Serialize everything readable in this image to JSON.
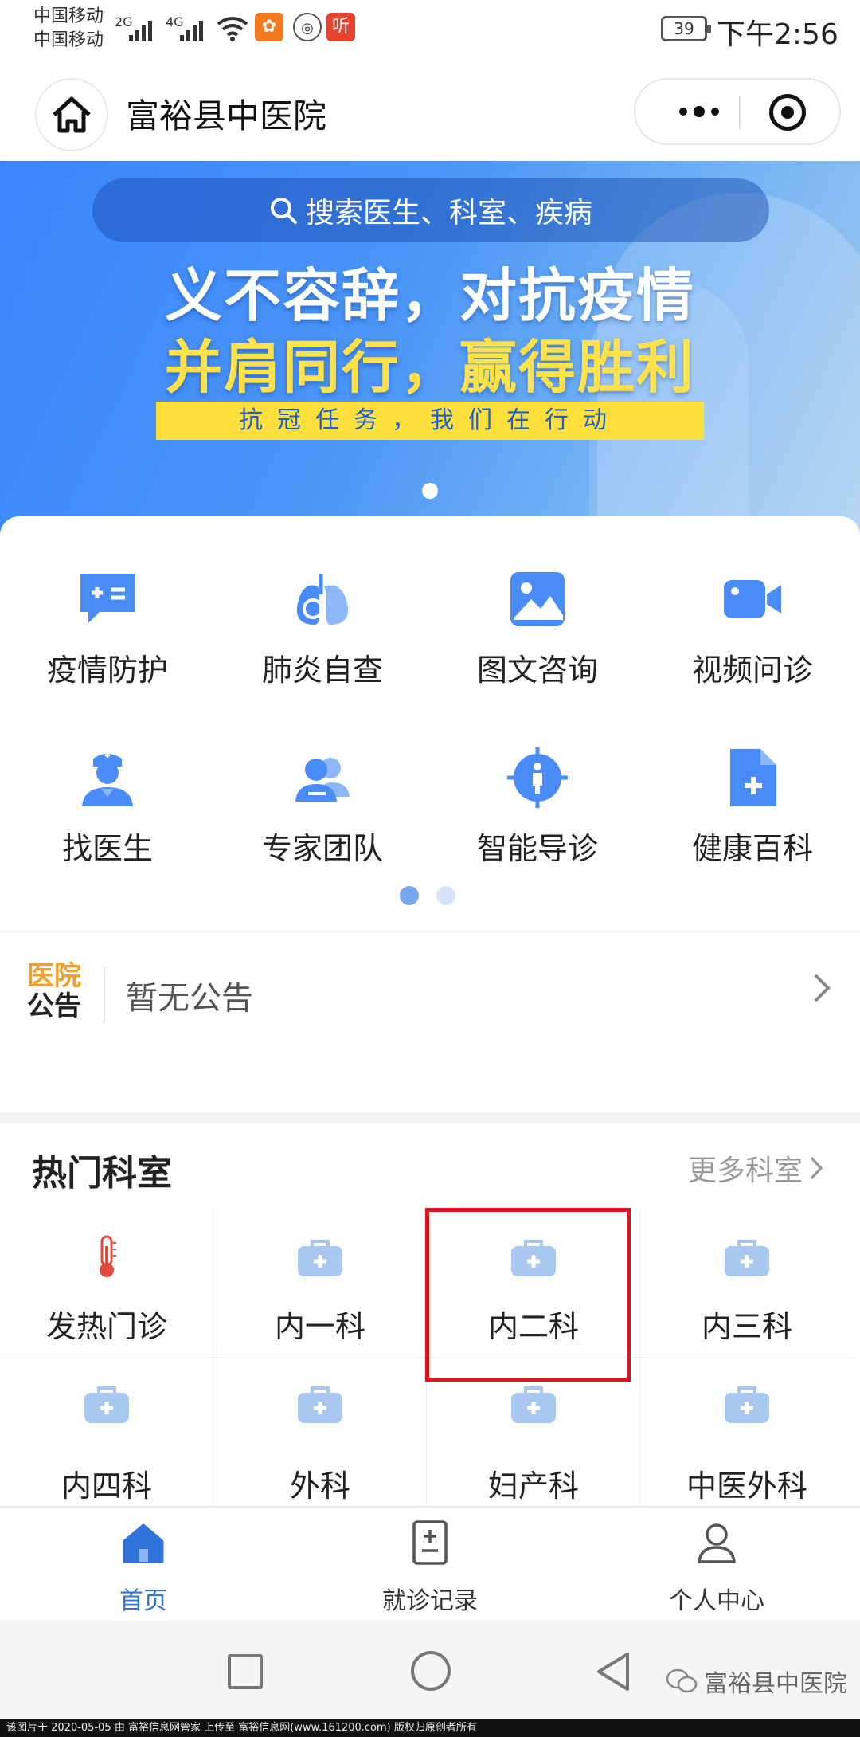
{
  "status_bar": {
    "carrier1": "中国移动",
    "carrier2": "中国移动",
    "net1": "2G",
    "net2": "4G",
    "battery": "39",
    "time": "下午2:56",
    "app_icon_listen": "听"
  },
  "title_bar": {
    "title": "富裕县中医院"
  },
  "banner": {
    "search_placeholder": "搜索医生、科室、疾病",
    "slogan_line1": "义不容辞，对抗疫情",
    "slogan_line2": "并肩同行，赢得胜利",
    "ribbon": "抗冠任务，我们在行动"
  },
  "services": [
    {
      "label": "疫情防护",
      "icon": "chat-plus-minus-icon"
    },
    {
      "label": "肺炎自查",
      "icon": "lungs-icon"
    },
    {
      "label": "图文咨询",
      "icon": "image-icon"
    },
    {
      "label": "视频问诊",
      "icon": "video-camera-icon"
    },
    {
      "label": "找医生",
      "icon": "doctor-icon"
    },
    {
      "label": "专家团队",
      "icon": "team-icon"
    },
    {
      "label": "智能导诊",
      "icon": "target-person-icon"
    },
    {
      "label": "健康百科",
      "icon": "document-plus-icon"
    }
  ],
  "notice": {
    "badge_line1": "医院",
    "badge_line2": "公告",
    "text": "暂无公告"
  },
  "departments": {
    "heading": "热门科室",
    "more_label": "更多科室",
    "items": [
      {
        "label": "发热门诊",
        "icon": "thermometer-icon"
      },
      {
        "label": "内一科",
        "icon": "medical-kit-icon"
      },
      {
        "label": "内二科",
        "icon": "medical-kit-icon"
      },
      {
        "label": "内三科",
        "icon": "medical-kit-icon"
      },
      {
        "label": "内四科",
        "icon": "medical-kit-icon"
      },
      {
        "label": "外科",
        "icon": "medical-kit-icon"
      },
      {
        "label": "妇产科",
        "icon": "medical-kit-icon"
      },
      {
        "label": "中医外科",
        "icon": "medical-kit-icon"
      }
    ]
  },
  "tab_bar": {
    "tabs": [
      {
        "label": "首页",
        "icon": "home-icon",
        "active": true
      },
      {
        "label": "就诊记录",
        "icon": "record-icon",
        "active": false
      },
      {
        "label": "个人中心",
        "icon": "user-icon",
        "active": false
      }
    ]
  },
  "watermark": "富裕县中医院",
  "footer": "该图片于 2020-05-05 由 富裕信息网管家 上传至 富裕信息网(www.161200.com) 版权归原创者所有",
  "colors": {
    "primary": "#3b86ff",
    "icon_blue": "#4a8cf7",
    "highlight_red": "#e0141e",
    "notice_orange": "#f0a02a",
    "slogan_yellow": "#ffe24a"
  }
}
